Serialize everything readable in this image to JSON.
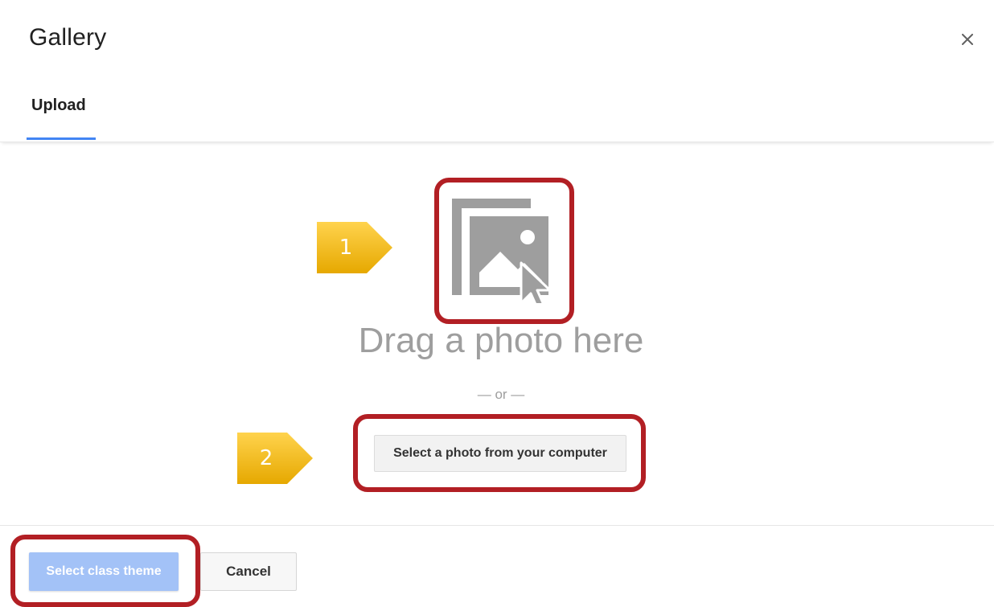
{
  "dialog": {
    "title": "Gallery",
    "close_icon": "close-icon",
    "close_glyph": "×"
  },
  "tabs": [
    {
      "label": "Upload",
      "active": true
    }
  ],
  "upload": {
    "icon": "photo-gallery-icon",
    "drag_text": "Drag a photo here",
    "or_text": "— or —",
    "select_button_label": "Select a photo from your computer"
  },
  "footer": {
    "primary_label": "Select class theme",
    "cancel_label": "Cancel"
  },
  "annotations": {
    "step_1": "1",
    "step_2": "2"
  },
  "colors": {
    "accent": "#4285f4",
    "primary_disabled": "#a3c2f7",
    "highlight": "#b21f24",
    "callout": "#f5b800"
  }
}
